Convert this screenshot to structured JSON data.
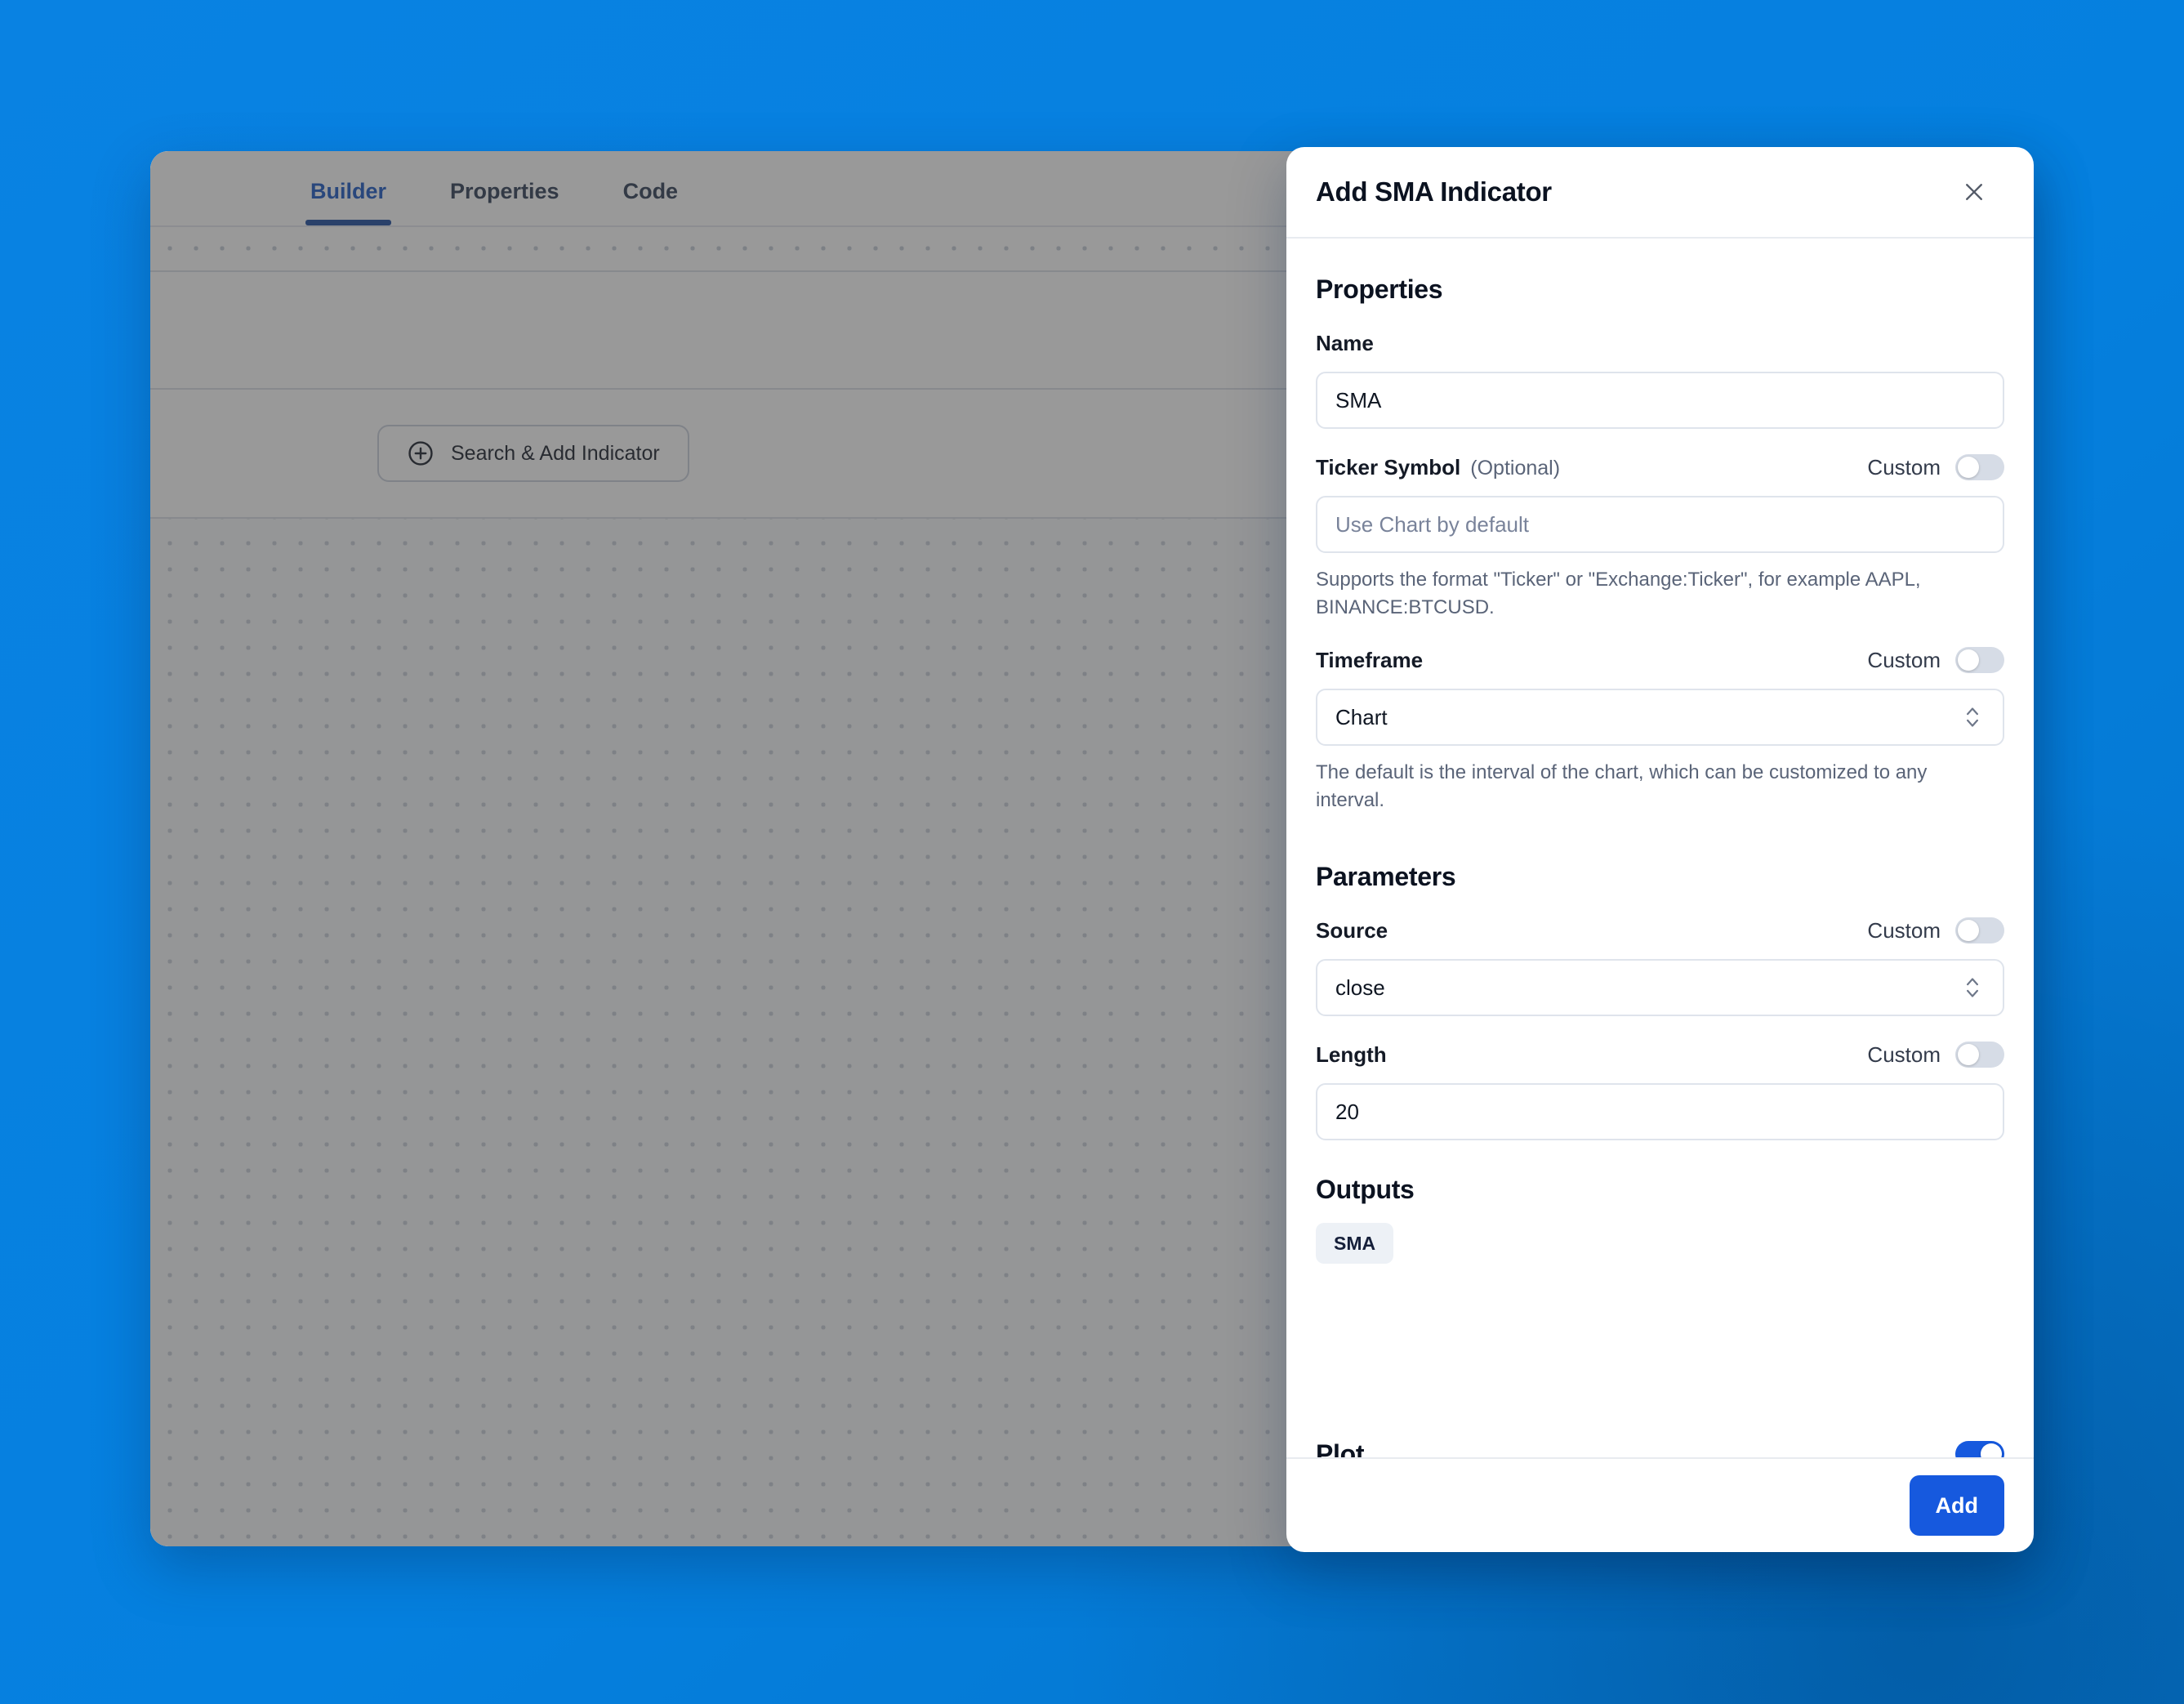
{
  "background": {
    "color": "#0580DF"
  },
  "app": {
    "tabs": [
      {
        "label": "Builder",
        "active": true
      },
      {
        "label": "Properties",
        "active": false
      },
      {
        "label": "Code",
        "active": false
      }
    ],
    "toolbar": {
      "add_icon": "plus-icon",
      "edit_icon": "pencil-icon"
    },
    "add_indicator_button": {
      "label": "Search & Add Indicator",
      "icon": "plus-circle-icon"
    }
  },
  "modal": {
    "title": "Add SMA Indicator",
    "close_icon": "close-icon",
    "sections": {
      "properties": {
        "heading": "Properties",
        "name": {
          "label": "Name",
          "value": "SMA"
        },
        "ticker_symbol": {
          "label": "Ticker Symbol",
          "optional": "(Optional)",
          "custom_label": "Custom",
          "custom_on": false,
          "placeholder": "Use Chart by default",
          "value": "",
          "help": "Supports the format \"Ticker\" or \"Exchange:Ticker\", for example AAPL, BINANCE:BTCUSD."
        },
        "timeframe": {
          "label": "Timeframe",
          "custom_label": "Custom",
          "custom_on": false,
          "value": "Chart",
          "help": "The default is the interval of the chart, which can be customized to any interval."
        }
      },
      "parameters": {
        "heading": "Parameters",
        "source": {
          "label": "Source",
          "custom_label": "Custom",
          "custom_on": false,
          "value": "close"
        },
        "length": {
          "label": "Length",
          "custom_label": "Custom",
          "custom_on": false,
          "value": "20"
        }
      },
      "outputs": {
        "heading": "Outputs",
        "chips": [
          "SMA"
        ]
      },
      "plot": {
        "heading": "Plot",
        "toggle_on": true
      }
    },
    "footer": {
      "add_label": "Add"
    }
  },
  "colors": {
    "accent_blue": "#1659DE",
    "tab_active": "#1554C2",
    "page_background": "#0580DF",
    "toggle_off_track": "#D6DCE6"
  }
}
